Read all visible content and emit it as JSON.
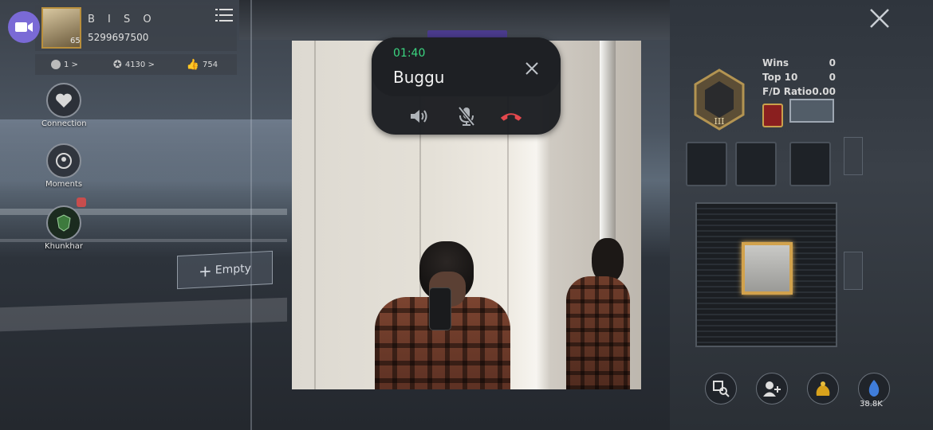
{
  "profile": {
    "name": "B I S O",
    "id": "5299697500",
    "level": "65"
  },
  "stats_bar": {
    "item1": "1 >",
    "item2": "4130 >",
    "item3": "754"
  },
  "side_buttons": {
    "connection": "Connection",
    "moments": "Moments",
    "clan": "Khunkhar"
  },
  "empty_slot": {
    "label": "Empty"
  },
  "right_stats": {
    "rows": [
      {
        "label": "Wins",
        "value": "0"
      },
      {
        "label": "Top 10",
        "value": "0"
      },
      {
        "label": "F/D Ratio",
        "value": "0.00"
      }
    ],
    "tier": "III"
  },
  "bottom_bar": {
    "popularity": "38.8K"
  },
  "call": {
    "timer": "01:40",
    "caller": "Buggu",
    "colors": {
      "timer": "#3bd680",
      "end_call": "#e5484d"
    }
  },
  "icons": [
    "video-icon",
    "menu-icon",
    "heart-icon",
    "moments-icon",
    "clan-icon",
    "close-icon",
    "speaker-icon",
    "mic-off-icon",
    "end-call-icon",
    "search-icon",
    "add-friend-icon",
    "popularity-icon"
  ]
}
